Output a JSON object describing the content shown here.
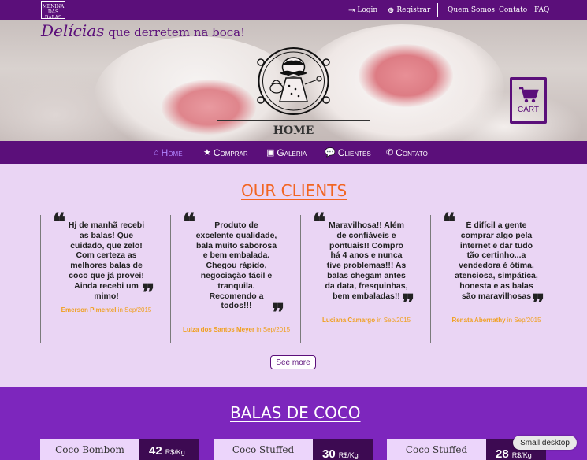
{
  "brand": {
    "logo_text": "MENINA DAS BALAS"
  },
  "topnav": {
    "login": "Login",
    "register": "Registrar",
    "about": "Quem Somos",
    "contact": "Contato",
    "faq": "FAQ"
  },
  "hero": {
    "tagline_big": "Delícias",
    "tagline_small": " que derretem na boca!",
    "title": "HOME",
    "cart_label": "CART"
  },
  "mainnav": [
    {
      "label": "Home",
      "icon": "home-icon",
      "active": true
    },
    {
      "label": "Comprar",
      "icon": "star-icon"
    },
    {
      "label": "Galeria",
      "icon": "image-icon"
    },
    {
      "label": "Clientes",
      "icon": "comments-icon"
    },
    {
      "label": "Contato",
      "icon": "phone-icon"
    }
  ],
  "clients": {
    "title": "OUR CLIENTS",
    "testimonials": [
      {
        "text": "Hj de manhã recebi as balas! Que cuidado, que zelo! Com certeza as melhores balas de coco que já provei! Ainda recebi um mimo!",
        "author": "Emerson Pimentel",
        "date": " in Sep/2015"
      },
      {
        "text": "Produto de excelente qualidade, bala muito saborosa e bem embalada. Chegou rápido, negociação fácil e tranquila. Recomendo a todos!!!",
        "author": "Luiza dos Santos Meyer",
        "date": " in Sep/2015"
      },
      {
        "text": "Maravilhosa!! Além de confiáveis e pontuais!! Compro há 4 anos e nunca tive problemas!!! As balas chegam antes da data, fresquinhas, bem embaladas!!",
        "author": "Luciana Camargo",
        "date": " in Sep/2015"
      },
      {
        "text": "É difícil a gente comprar algo pela internet e dar tudo tão certinho...a vendedora é ótima, atenciosa, simpática, honesta e as balas são maravilhosas",
        "author": "Renata Abernathy",
        "date": " in Sep/2015"
      }
    ],
    "see_more": "See more"
  },
  "products": {
    "title": "BALAS DE COCO",
    "items": [
      {
        "name": "Coco Bombom",
        "price": "42",
        "unit": "R$/Kg"
      },
      {
        "name": "Coco Stuffed",
        "price": "30",
        "unit": "R$/Kg"
      },
      {
        "name": "Coco Stuffed",
        "price": "28",
        "unit": "R$/Kg"
      }
    ]
  },
  "badge": "Small desktop",
  "colors": {
    "purple_dark": "#5b0f7a",
    "purple_mid": "#7d26bd",
    "orange": "#f26522",
    "lavender": "#ead5f4"
  }
}
